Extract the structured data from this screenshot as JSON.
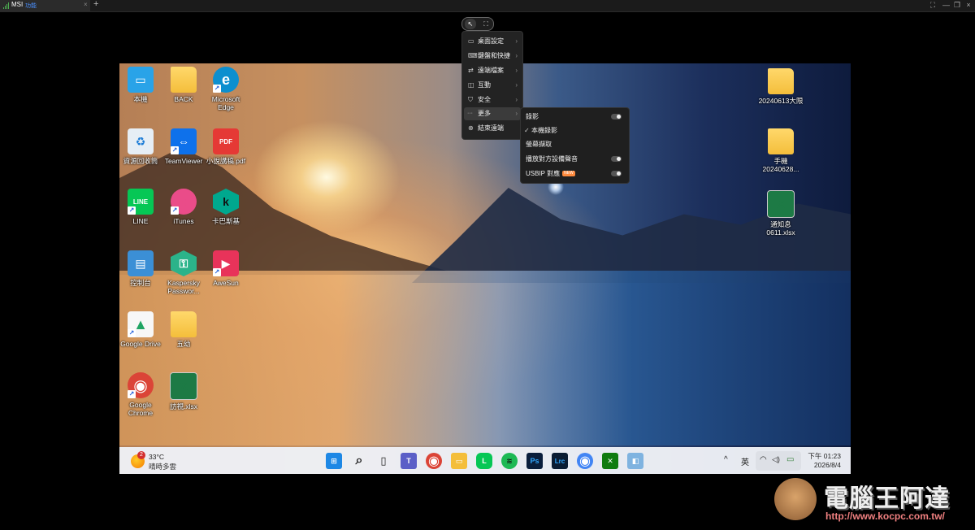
{
  "window": {
    "tab_name": "MSI",
    "tab_sub": "功能",
    "tab_close": "×",
    "new_tab": "+",
    "controls": [
      "⛶",
      "—",
      "❐",
      "×"
    ]
  },
  "remote_toolbar": {
    "pointer_icon": "↖",
    "fullscreen_icon": "⛶"
  },
  "menu": {
    "items": [
      {
        "icon": "▭",
        "label": "桌面設定",
        "arrow": "›"
      },
      {
        "icon": "⌨",
        "label": "鍵盤和快捷",
        "arrow": "›"
      },
      {
        "icon": "⇄",
        "label": "遠端檔案",
        "arrow": "›"
      },
      {
        "icon": "◫",
        "label": "互動",
        "arrow": "›"
      },
      {
        "icon": "⛉",
        "label": "安全",
        "arrow": "›"
      },
      {
        "icon": "···",
        "label": "更多",
        "arrow": "›"
      },
      {
        "icon": "⊗",
        "label": "結束遠端",
        "arrow": ""
      }
    ]
  },
  "submenu": {
    "items": [
      {
        "label": "錄影",
        "check": "",
        "toggle": true,
        "badge": ""
      },
      {
        "label": "本機錄影",
        "check": "✓",
        "toggle": false,
        "badge": ""
      },
      {
        "label": "螢幕擷取",
        "check": "",
        "toggle": false,
        "badge": ""
      },
      {
        "label": "播放對方設備聲音",
        "check": "",
        "toggle": true,
        "badge": ""
      },
      {
        "label": "USBIP 對應",
        "check": "",
        "toggle": true,
        "badge": "NEW"
      }
    ]
  },
  "desktop": {
    "icons": [
      {
        "label": "本機",
        "glyph": "▭",
        "color": "#29a3e8"
      },
      {
        "label": "BACK",
        "glyph": "",
        "color": "#f4be3b"
      },
      {
        "label": "Microsoft Edge",
        "glyph": "e",
        "color": "#0c8fcf"
      },
      {
        "label": "資源回收筒",
        "glyph": "♻",
        "color": "#e6eef5"
      },
      {
        "label": "TeamViewer",
        "glyph": "⇔",
        "color": "#0e71eb"
      },
      {
        "label": "小說講稿.pdf",
        "glyph": "PDF",
        "color": "#e53935"
      },
      {
        "label": "LINE",
        "glyph": "LINE",
        "color": "#06c755"
      },
      {
        "label": "iTunes",
        "glyph": "♫",
        "color": "#ea4c89"
      },
      {
        "label": "卡巴斯基",
        "glyph": "k",
        "color": "#00a88e"
      },
      {
        "label": "控制台",
        "glyph": "▤",
        "color": "#3b8fd6"
      },
      {
        "label": "Kaspersky Passwor...",
        "glyph": "⚿",
        "color": "#2bb38a"
      },
      {
        "label": "AweSun",
        "glyph": "▶",
        "color": "#e8335a"
      },
      {
        "label": "Google Drive",
        "glyph": "▲",
        "color": "#f7f7f7"
      },
      {
        "label": "五幼",
        "glyph": "",
        "color": "#f4be3b"
      },
      {
        "label": "Google Chrome",
        "glyph": "◉",
        "color": "#db4437"
      },
      {
        "label": "訪視.xlsx",
        "glyph": "X",
        "color": "#1d7a45"
      },
      {
        "label": "20240613大限",
        "glyph": "",
        "color": "#f4be3b"
      },
      {
        "label": "手機 20240628...",
        "glyph": "",
        "color": "#f4be3b"
      },
      {
        "label": "通知息 0611.xlsx",
        "glyph": "X",
        "color": "#1d7a45"
      }
    ]
  },
  "taskbar": {
    "weather_badge": "2",
    "weather_temp": "33°C",
    "weather_desc": "晴時多雲",
    "apps": [
      {
        "name": "start",
        "glyph": "⊞",
        "color": "#1e88e5"
      },
      {
        "name": "search",
        "glyph": "⌕",
        "color": "transparent"
      },
      {
        "name": "task-view",
        "glyph": "▯",
        "color": "transparent"
      },
      {
        "name": "teams",
        "glyph": "T",
        "color": "#5b5fc7"
      },
      {
        "name": "chrome",
        "glyph": "◉",
        "color": "#db4437"
      },
      {
        "name": "explorer",
        "glyph": "▭",
        "color": "#f4be3b"
      },
      {
        "name": "line",
        "glyph": "L",
        "color": "#06c755"
      },
      {
        "name": "spotify",
        "glyph": "≋",
        "color": "#1db954"
      },
      {
        "name": "photoshop",
        "glyph": "Ps",
        "color": "#0a1e3c"
      },
      {
        "name": "lightroom",
        "glyph": "Lrc",
        "color": "#0b1d33"
      },
      {
        "name": "chrome-2",
        "glyph": "◉",
        "color": "#4285f4"
      },
      {
        "name": "xbox",
        "glyph": "✕",
        "color": "#107c10"
      },
      {
        "name": "app",
        "glyph": "◧",
        "color": "#7fb3e0"
      }
    ],
    "tray_chevron": "^",
    "ime": "英",
    "wifi": "◠",
    "volume": "◁)",
    "battery": "▭",
    "time": "下午 01:23",
    "date": "2026/8/4"
  },
  "watermark": {
    "title": "電腦王阿達",
    "url": "http://www.kocpc.com.tw/"
  }
}
